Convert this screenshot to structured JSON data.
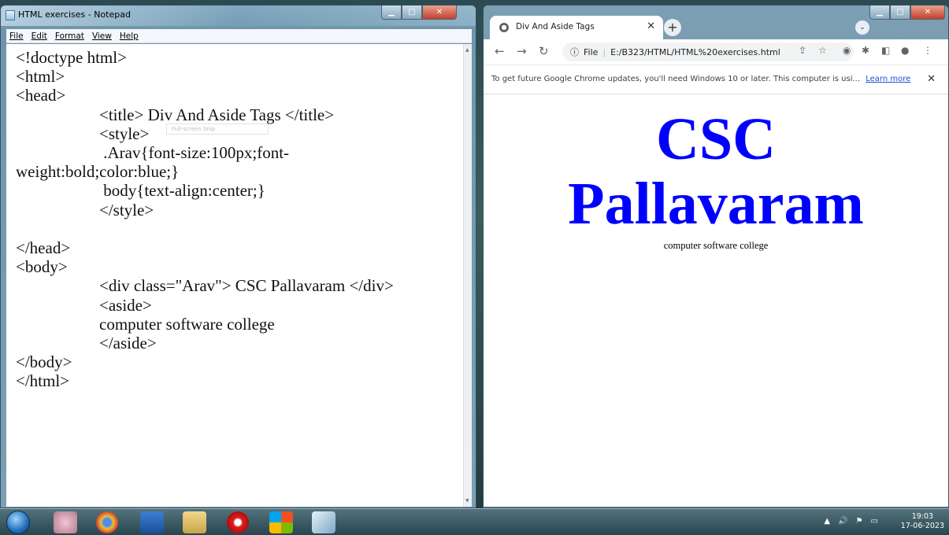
{
  "notepad": {
    "title": "HTML exercises - Notepad",
    "menu": [
      "File",
      "Edit",
      "Format",
      "View",
      "Help"
    ],
    "lines": [
      {
        "text": "<!doctype html>",
        "indent": false
      },
      {
        "text": "<html>",
        "indent": false
      },
      {
        "text": "<head>",
        "indent": false
      },
      {
        "text": "<title> Div And Aside Tags </title>",
        "indent": true
      },
      {
        "text": "<style>",
        "indent": true
      },
      {
        "text": " .Arav{font-size:100px;font-",
        "indent": true
      },
      {
        "text": "weight:bold;color:blue;}",
        "indent": false
      },
      {
        "text": " body{text-align:center;}",
        "indent": true
      },
      {
        "text": "</style>",
        "indent": true
      },
      {
        "text": "",
        "indent": false
      },
      {
        "text": "</head>",
        "indent": false
      },
      {
        "text": "<body>",
        "indent": false
      },
      {
        "text": "<div class=\"Arav\"> CSC Pallavaram </div>",
        "indent": true
      },
      {
        "text": "<aside>",
        "indent": true
      },
      {
        "text": "computer software college",
        "indent": true
      },
      {
        "text": "</aside>",
        "indent": true
      },
      {
        "text": "</body>",
        "indent": false
      },
      {
        "text": "</html>",
        "indent": false
      }
    ],
    "snip_tooltip": "Full-screen Snip"
  },
  "chrome": {
    "tab_title": "Div And Aside Tags",
    "address_prefix": "File",
    "address": "E:/B323/HTML/HTML%20exercises.html",
    "infobar_text": "To get future Google Chrome updates, you'll need Windows 10 or later. This computer is usi...",
    "infobar_link": "Learn more",
    "page": {
      "heading": "CSC Pallavaram",
      "aside": "computer software college",
      "heading_color": "#0000ff"
    }
  },
  "taskbar": {
    "time": "19:03",
    "date": "17-06-2023",
    "apps": [
      "paint-icon",
      "chrome-icon",
      "outlook-icon",
      "explorer-icon",
      "opera-icon",
      "winlogo-icon",
      "snipping-icon"
    ]
  }
}
